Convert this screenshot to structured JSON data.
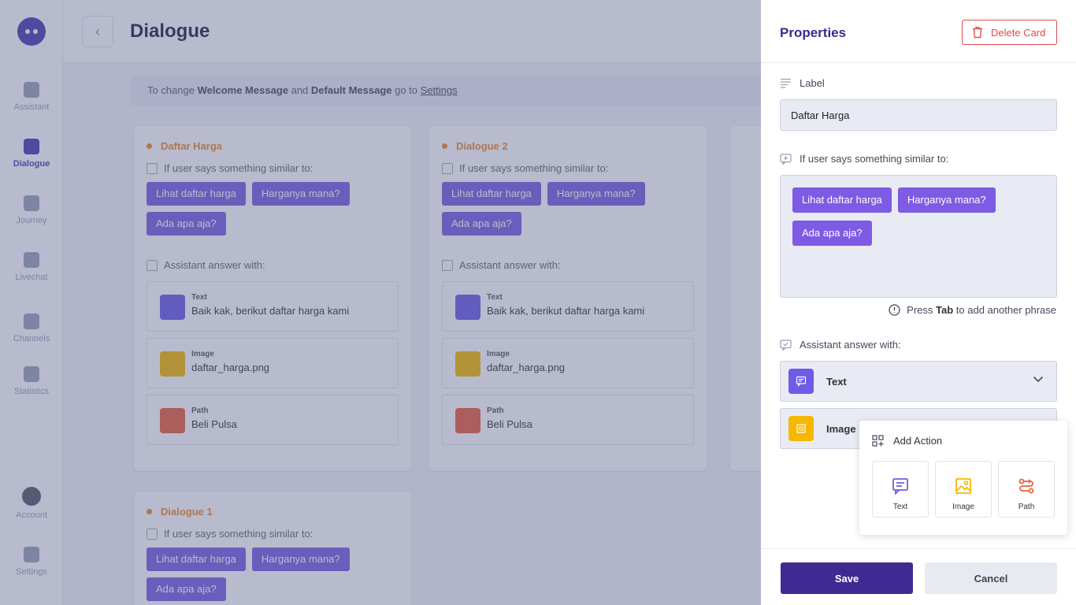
{
  "sidebar": {
    "items": [
      {
        "label": "Assistant",
        "icon": "home-icon"
      },
      {
        "label": "Dialogue",
        "icon": "chat-icon",
        "active": true
      },
      {
        "label": "Journey",
        "icon": "flow-icon"
      },
      {
        "label": "Livechat",
        "icon": "send-icon"
      },
      {
        "label": "Channels",
        "icon": "channels-icon"
      },
      {
        "label": "Statistics",
        "icon": "bar-chart-icon"
      },
      {
        "label": "Account",
        "icon": "avatar"
      },
      {
        "label": "Settings",
        "icon": "gear-icon"
      }
    ]
  },
  "header": {
    "title": "Dialogue",
    "back_icon": "chevron-left-icon"
  },
  "banner": {
    "prefix": "To change ",
    "welcome": "Welcome Message",
    "and": " and ",
    "default": "Default Message",
    "goto": " go to ",
    "link": "Settings"
  },
  "cards": [
    {
      "title": "Daftar Harga",
      "if_label": "If user says something similar to:",
      "phrases": [
        "Lihat daftar harga",
        "Harganya mana?",
        "Ada apa aja?"
      ],
      "answer_label": "Assistant answer with:",
      "answers": [
        {
          "type": "Text",
          "value": "Baik kak, berikut daftar harga kami",
          "color": "#6c5ce7"
        },
        {
          "type": "Image",
          "value": "daftar_harga.png",
          "color": "#f5b800"
        },
        {
          "type": "Path",
          "value": "Beli Pulsa",
          "color": "#e8603c"
        }
      ]
    },
    {
      "title": "Dialogue 2",
      "if_label": "If user says something similar to:",
      "phrases": [
        "Lihat daftar harga",
        "Harganya mana?",
        "Ada apa aja?"
      ],
      "answer_label": "Assistant answer with:",
      "answers": [
        {
          "type": "Text",
          "value": "Baik kak, berikut daftar harga kami",
          "color": "#6c5ce7"
        },
        {
          "type": "Image",
          "value": "daftar_harga.png",
          "color": "#f5b800"
        },
        {
          "type": "Path",
          "value": "Beli Pulsa",
          "color": "#e8603c"
        }
      ]
    },
    {
      "title": "Dialogue 1",
      "if_label": "If user says something similar to:",
      "phrases": [
        "Lihat daftar harga",
        "Harganya mana?",
        "Ada apa aja?"
      ]
    }
  ],
  "panel": {
    "title": "Properties",
    "delete_label": "Delete Card",
    "label_field": {
      "label": "Label",
      "value": "Daftar Harga"
    },
    "phrases_field": {
      "label": "If user says something similar to:",
      "phrases": [
        "Lihat daftar harga",
        "Harganya mana?",
        "Ada apa aja?"
      ]
    },
    "hint": {
      "pre": "Press ",
      "key": "Tab",
      "post": " to add another phrase"
    },
    "answer_label": "Assistant answer with:",
    "actions": [
      {
        "label": "Text",
        "color": "#6c5ce7"
      },
      {
        "label": "Image",
        "color": "#f5b800"
      }
    ],
    "add_action": {
      "title": "Add Action",
      "options": [
        {
          "label": "Text",
          "icon": "text-message-icon",
          "color": "#6c5ce7"
        },
        {
          "label": "Image",
          "icon": "image-icon",
          "color": "#f5b800"
        },
        {
          "label": "Path",
          "icon": "path-icon",
          "color": "#e8603c"
        }
      ]
    },
    "save_label": "Save",
    "cancel_label": "Cancel"
  }
}
